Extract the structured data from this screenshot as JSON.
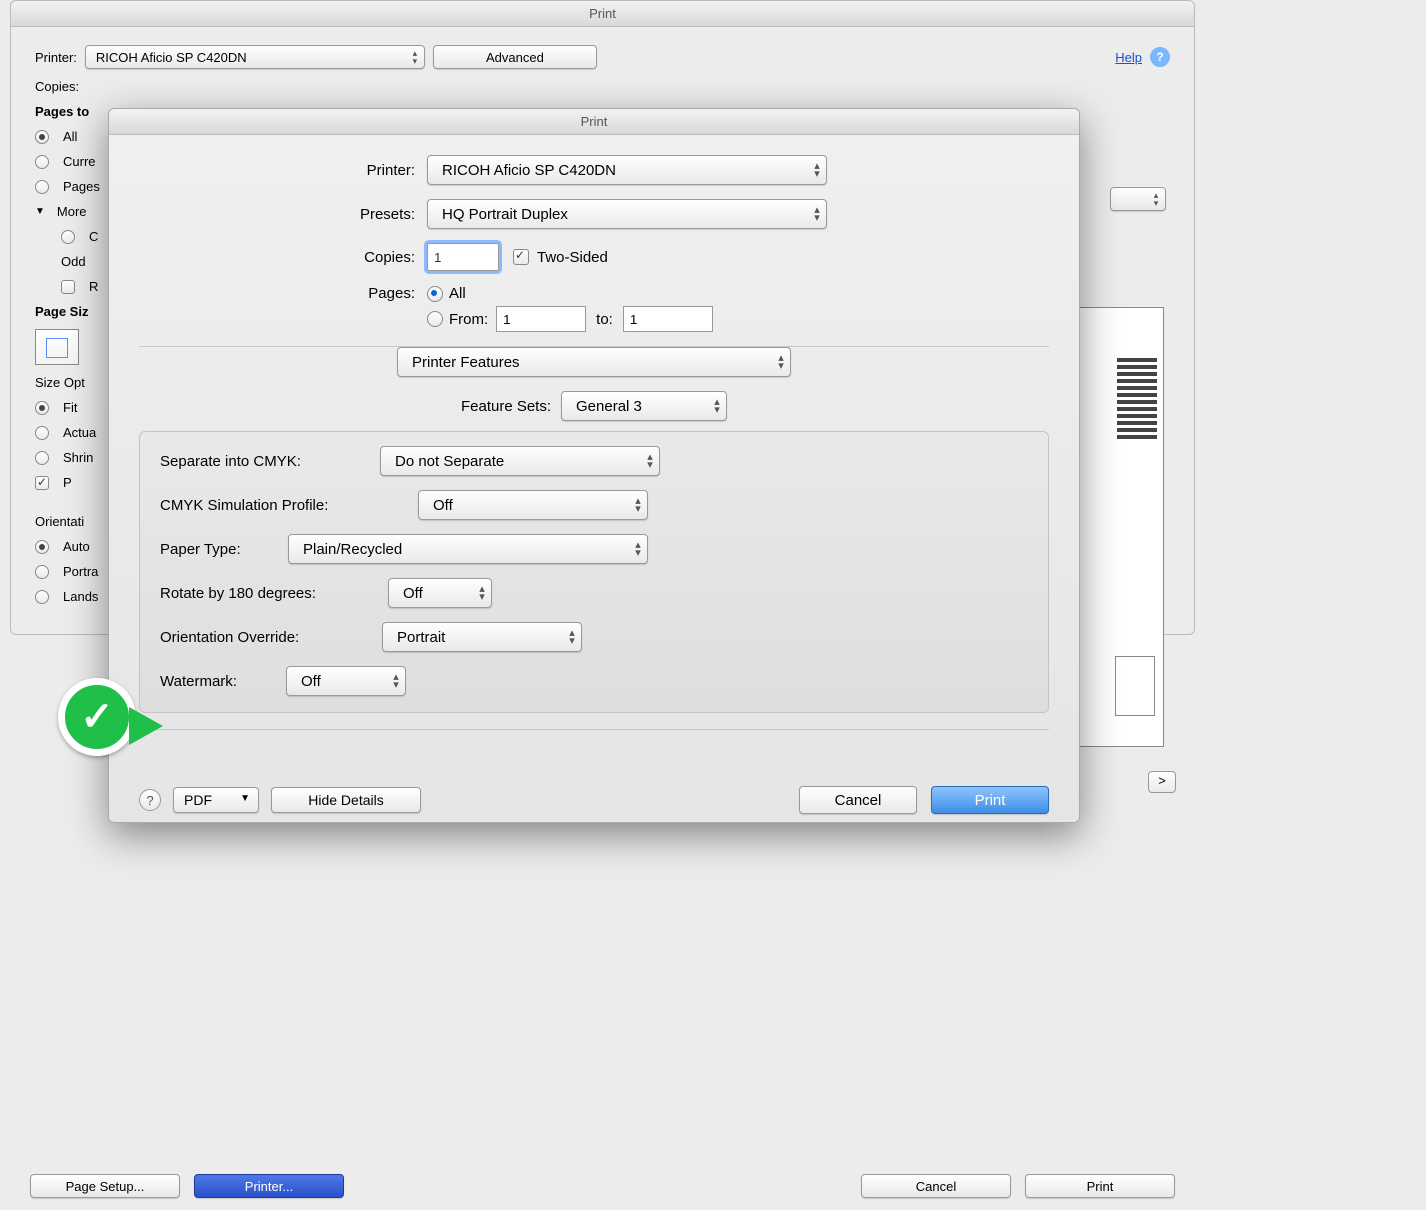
{
  "back": {
    "title": "Print",
    "printer_label": "Printer:",
    "printer_value": "RICOH Aficio SP C420DN",
    "advanced_btn": "Advanced",
    "help_text": "Help",
    "copies_label": "Copies:",
    "pages_to_label": "Pages to",
    "all_label": "All",
    "current_label": "Curre",
    "pages_label": "Pages",
    "more_label": "More",
    "c_label": "C",
    "odd_label": "Odd",
    "r_label": "R",
    "page_siz_label": "Page Siz",
    "size_opt_label": "Size Opt",
    "fit_label": "Fit",
    "actual_label": "Actua",
    "shrin_label": "Shrin",
    "p_label": "P",
    "orientati_label": "Orientati",
    "auto_label": "Auto",
    "portra_label": "Portra",
    "lands_label": "Lands",
    "next_label": ">",
    "page_setup_btn": "Page Setup...",
    "printer_btn": "Printer...",
    "cancel_btn": "Cancel",
    "print_btn": "Print"
  },
  "modal": {
    "title": "Print",
    "printer_label": "Printer:",
    "printer_value": "RICOH Aficio SP C420DN",
    "presets_label": "Presets:",
    "presets_value": "HQ Portrait Duplex",
    "copies_label": "Copies:",
    "copies_value": "1",
    "two_sided_label": "Two-Sided",
    "pages_label": "Pages:",
    "pages_all_label": "All",
    "pages_from_label": "From:",
    "pages_from_value": "1",
    "pages_to_label": "to:",
    "pages_to_value": "1",
    "section_select": "Printer Features",
    "feature_sets_label": "Feature Sets:",
    "feature_sets_value": "General 3",
    "separate_cmyk_label": "Separate into CMYK:",
    "separate_cmyk_value": "Do not Separate",
    "cmyk_profile_label": "CMYK Simulation Profile:",
    "cmyk_profile_value": "Off",
    "paper_type_label": "Paper Type:",
    "paper_type_value": "Plain/Recycled",
    "rotate_label": "Rotate by 180 degrees:",
    "rotate_value": "Off",
    "orientation_label": "Orientation Override:",
    "orientation_value": "Portrait",
    "watermark_label": "Watermark:",
    "watermark_value": "Off",
    "pdf_btn": "PDF",
    "hide_details_btn": "Hide Details",
    "cancel_btn": "Cancel",
    "print_btn": "Print"
  }
}
